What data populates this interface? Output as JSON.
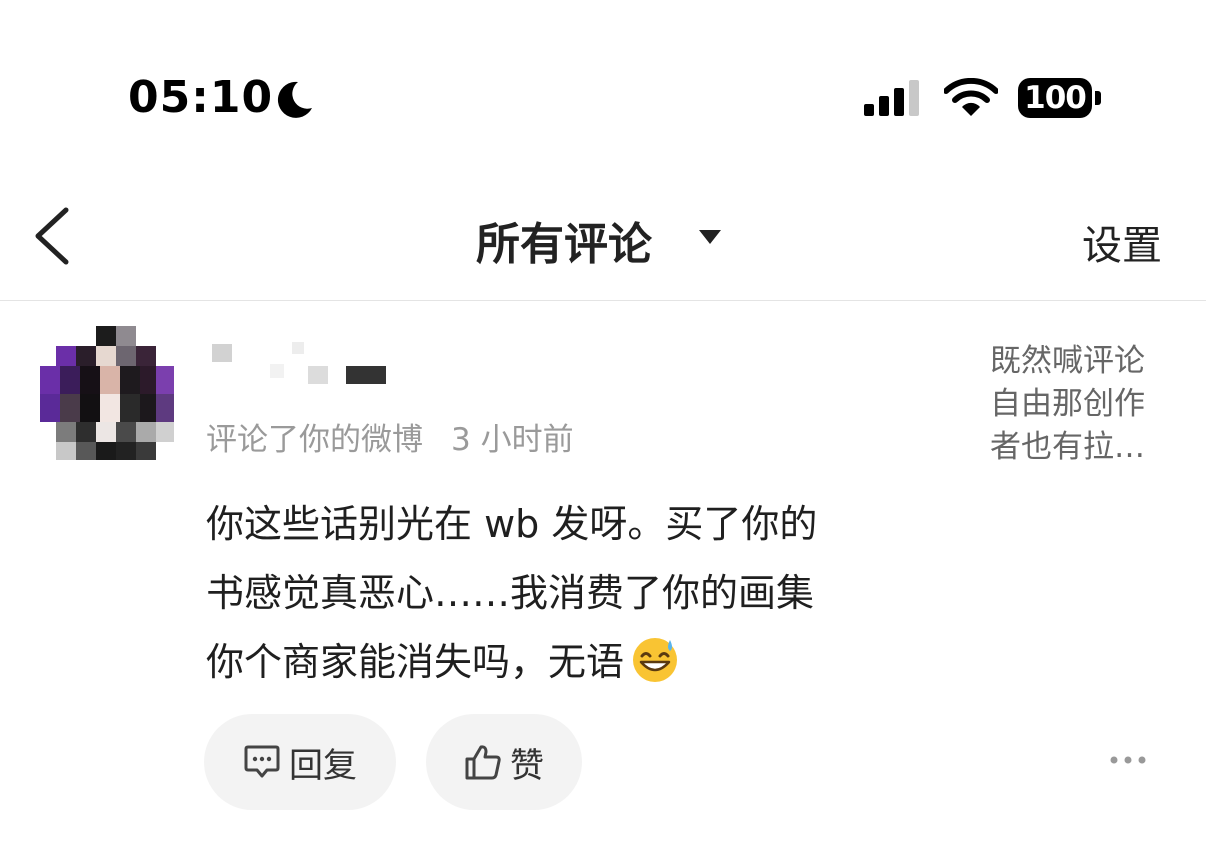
{
  "status_bar": {
    "time": "05:10",
    "battery": "100",
    "icons": [
      "moon-icon",
      "cellular-signal-icon",
      "wifi-icon",
      "battery-icon"
    ]
  },
  "nav": {
    "back_icon": "chevron-left-icon",
    "title": "所有评论",
    "dropdown_icon": "caret-down-icon",
    "settings_label": "设置"
  },
  "comment": {
    "avatar": "pixelated-avatar",
    "username": "",
    "action_text": "评论了你的微博",
    "time": "3 小时前",
    "lines": [
      "你这些话别光在 wb 发呀。买了你的",
      "书感觉真恶心……我消费了你的画集",
      "你个商家能消失吗，无语"
    ],
    "emoji": "grinning-sweat-emoji",
    "quoted_post_lines": [
      "既然喊评论",
      "自由那创作",
      "者也有拉…"
    ]
  },
  "actions": {
    "reply_label": "回复",
    "reply_icon": "comment-bubble-icon",
    "like_label": "赞",
    "like_icon": "thumbs-up-icon",
    "more_icon": "more-dots-icon"
  },
  "colors": {
    "accent_avatar": "#6a2fa8",
    "meta_text": "#9a9a9a",
    "button_bg": "#f3f3f3"
  }
}
